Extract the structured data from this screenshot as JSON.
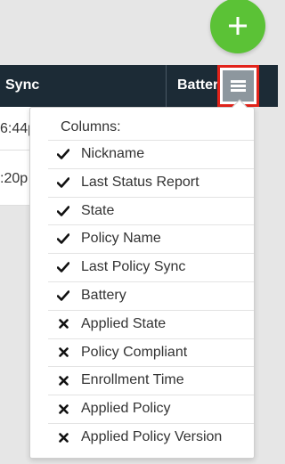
{
  "fab": {
    "icon": "plus-icon",
    "color": "#5bc236"
  },
  "table": {
    "header_background": "#1c2b36",
    "columns": [
      "Sync",
      "Battery"
    ],
    "rows": [
      {
        "sync": "6:44p"
      },
      {
        "sync": ":20p"
      }
    ]
  },
  "column_menu": {
    "button_icon": "hamburger-menu-icon",
    "highlight_color": "#e2231a",
    "title": "Columns:",
    "items": [
      {
        "label": "Nickname",
        "checked": true,
        "icon": "check-icon"
      },
      {
        "label": "Last Status Report",
        "checked": true,
        "icon": "check-icon"
      },
      {
        "label": "State",
        "checked": true,
        "icon": "check-icon"
      },
      {
        "label": "Policy Name",
        "checked": true,
        "icon": "check-icon"
      },
      {
        "label": "Last Policy Sync",
        "checked": true,
        "icon": "check-icon"
      },
      {
        "label": "Battery",
        "checked": true,
        "icon": "check-icon"
      },
      {
        "label": "Applied State",
        "checked": false,
        "icon": "x-icon"
      },
      {
        "label": "Policy Compliant",
        "checked": false,
        "icon": "x-icon"
      },
      {
        "label": "Enrollment Time",
        "checked": false,
        "icon": "x-icon"
      },
      {
        "label": "Applied Policy",
        "checked": false,
        "icon": "x-icon"
      },
      {
        "label": "Applied Policy Version",
        "checked": false,
        "icon": "x-icon"
      }
    ]
  }
}
